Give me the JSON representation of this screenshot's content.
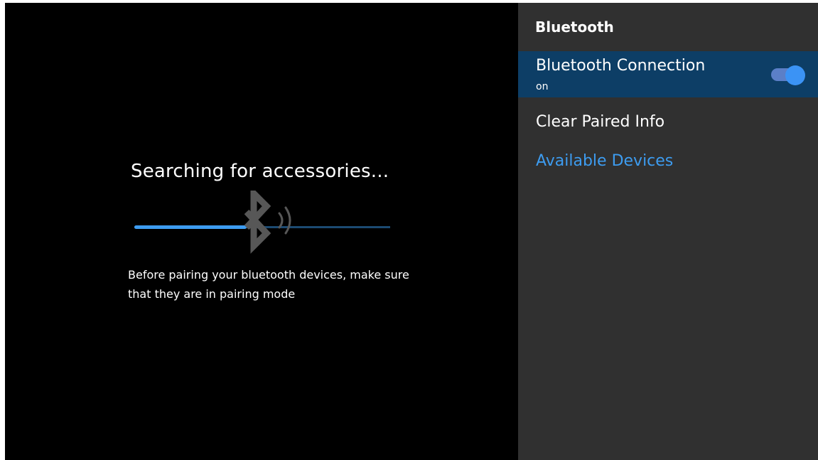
{
  "search": {
    "title": "Searching for accessories...",
    "hint": "Before pairing your bluetooth devices, make sure that they are in pairing mode",
    "progress_fraction": 0.44,
    "bluetooth_icon": "bluetooth-icon",
    "signal_icon": "signal-waves-icon"
  },
  "panel": {
    "title": "Bluetooth",
    "items": [
      {
        "label": "Bluetooth Connection",
        "sublabel": "on",
        "toggle_on": true,
        "selected": true
      },
      {
        "label": "Clear Paired Info"
      },
      {
        "label": "Available Devices"
      }
    ]
  },
  "colors": {
    "background": "#000000",
    "panel_background": "#303030",
    "selected_row": "#0d3e66",
    "accent": "#3d9cf0",
    "progress_track": "#1c4a72",
    "toggle_track": "#5b7fc7",
    "toggle_knob": "#3b93f5",
    "icon_gray": "#575757"
  }
}
